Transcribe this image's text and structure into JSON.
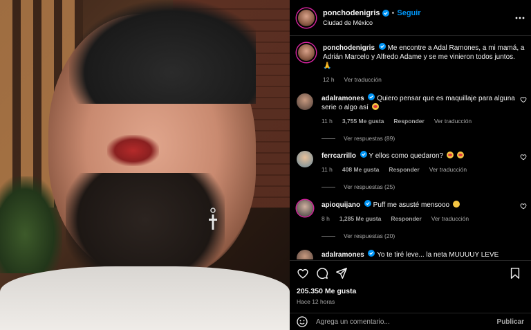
{
  "post": {
    "author": "ponchodenigris",
    "follow_label": "Seguir",
    "location": "Ciudad de México",
    "more_icon": "more-horizontal-icon",
    "photo_icon": "post-photo"
  },
  "caption": {
    "username": "ponchodenigris",
    "text": "Me encontre a Adal Ramones, a mi mamá, a Adrián Marcelo y Alfredo Adame y se me vinieron todos juntos. 🙏",
    "time": "12 h",
    "translate": "Ver traducción"
  },
  "comments": [
    {
      "username": "adalramones",
      "text": "Quiero pensar que es maquillaje para alguna serie o algo así",
      "time": "11 h",
      "likes": "3,755 Me gusta",
      "reply": "Responder",
      "translate": "Ver traducción",
      "replies": "Ver respuestas (89)"
    },
    {
      "username": "ferrcarrillo",
      "text": "Y ellos como quedaron?",
      "time": "11 h",
      "likes": "408 Me gusta",
      "reply": "Responder",
      "translate": "Ver traducción",
      "replies": "Ver respuestas (25)"
    },
    {
      "username": "apioquijano",
      "text": "Puff me asusté mensooo",
      "time": "8 h",
      "likes": "1,285 Me gusta",
      "reply": "Responder",
      "translate": "Ver traducción",
      "replies": "Ver respuestas (20)"
    },
    {
      "username": "adalramones",
      "text": "Yo te tiré leve... la neta MUUUUY LEVE"
    }
  ],
  "footer": {
    "likes": "205.350 Me gusta",
    "ago": "Hace 12 horas",
    "placeholder": "Agrega un comentario...",
    "publish": "Publicar"
  },
  "colors": {
    "accent": "#0095f6",
    "background": "#000000",
    "muted": "#a8a8a8"
  }
}
